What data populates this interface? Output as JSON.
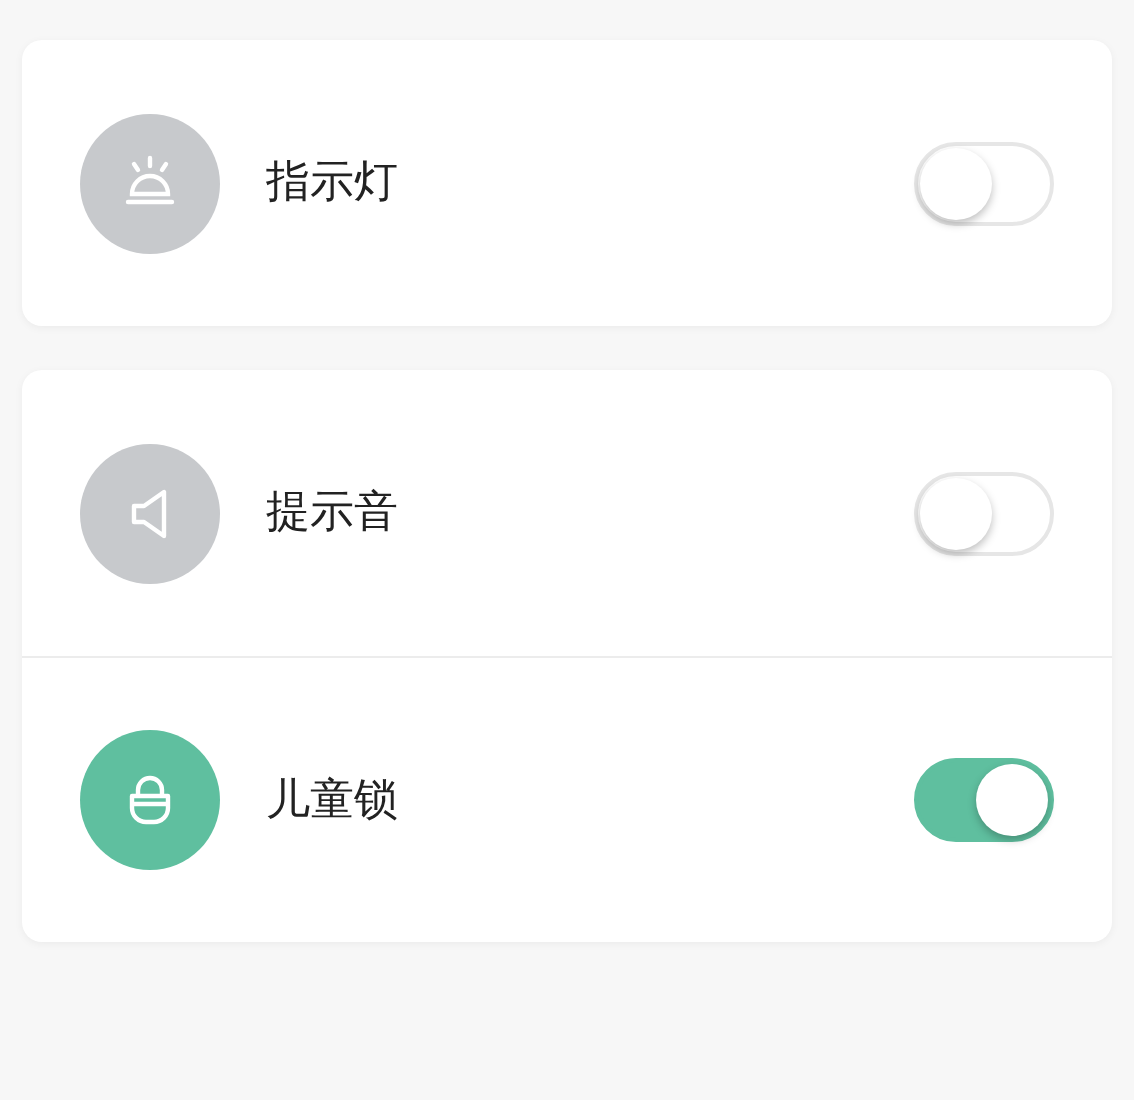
{
  "groups": [
    {
      "items": [
        {
          "kind": "indicator",
          "label": "指示灯",
          "on": false
        }
      ]
    },
    {
      "items": [
        {
          "kind": "sound",
          "label": "提示音",
          "on": false
        },
        {
          "kind": "lock",
          "label": "儿童锁",
          "on": true
        }
      ]
    }
  ]
}
